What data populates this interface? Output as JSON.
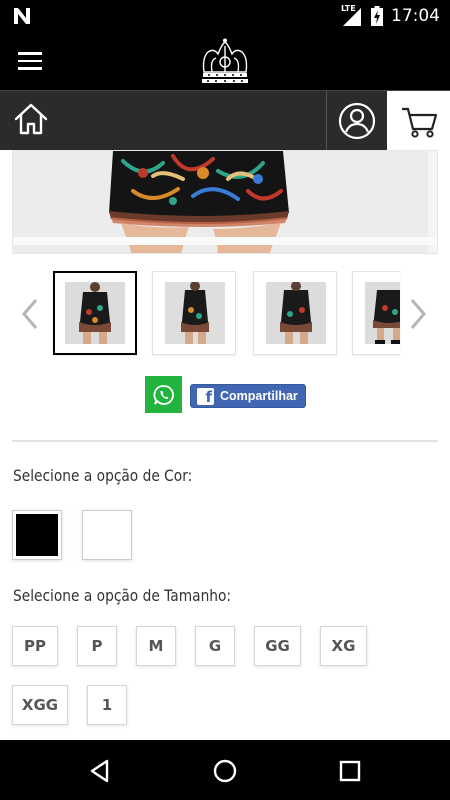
{
  "status_bar": {
    "time": "17:04",
    "network": "LTE"
  },
  "colors": {
    "whatsapp": "#22b43f",
    "facebook": "#4267b2",
    "appbar": "#000000",
    "navbar": "#2b2b2b"
  },
  "header": {
    "logo": "crown-logo",
    "menu_icon": "hamburger-icon"
  },
  "nav": {
    "home_icon": "home-icon",
    "user_icon": "user-icon",
    "cart_icon": "cart-icon"
  },
  "gallery": {
    "selected_index": 0,
    "thumbnails": [
      "dress-thumb-1",
      "dress-thumb-2",
      "dress-thumb-3",
      "dress-thumb-4"
    ]
  },
  "share": {
    "facebook_label": "Compartilhar",
    "whatsapp_icon": "whatsapp-icon"
  },
  "color_option": {
    "label": "Selecione a opção de Cor:",
    "swatches": [
      {
        "name": "black",
        "color": "#000000"
      },
      {
        "name": "white",
        "color": "#ffffff"
      }
    ]
  },
  "size_option": {
    "label": "Selecione a opção de Tamanho:",
    "sizes": [
      "PP",
      "P",
      "M",
      "G",
      "GG",
      "XG",
      "XGG",
      "1"
    ]
  }
}
